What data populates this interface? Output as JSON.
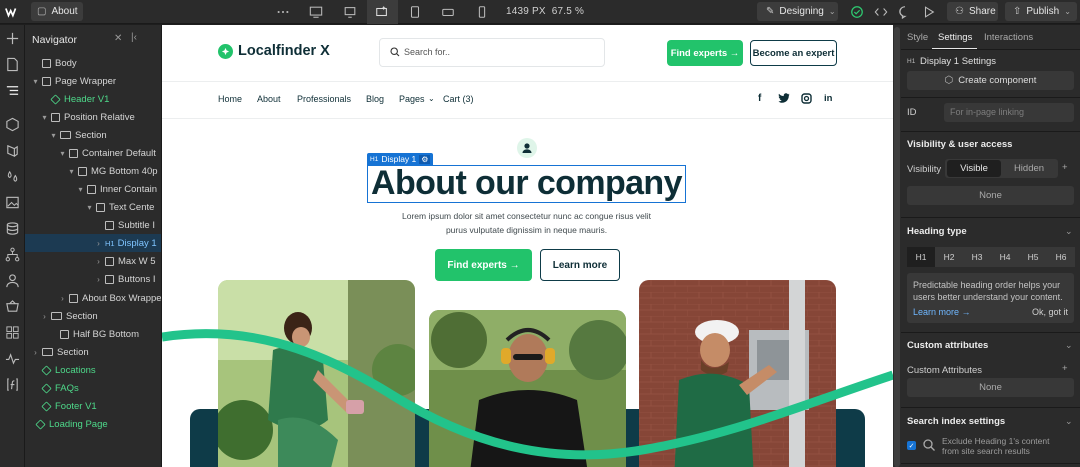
{
  "topbar": {
    "page_name": "About",
    "zoom_px": "1439 PX",
    "zoom_pct": "67.5 %",
    "mode": "Designing",
    "share": "Share",
    "publish": "Publish"
  },
  "navigator": {
    "title": "Navigator",
    "items": [
      {
        "label": "Body"
      },
      {
        "label": "Page Wrapper"
      },
      {
        "label": "Header V1"
      },
      {
        "label": "Position Relative"
      },
      {
        "label": "Section"
      },
      {
        "label": "Container Default"
      },
      {
        "label": "MG Bottom 40p"
      },
      {
        "label": "Inner Contain"
      },
      {
        "label": "Text Cente"
      },
      {
        "label": "Subtitle I"
      },
      {
        "label": "Display 1"
      },
      {
        "label": "Max W 5"
      },
      {
        "label": "Buttons I"
      },
      {
        "label": "About Box Wrappe"
      },
      {
        "label": "Section"
      },
      {
        "label": "Half BG Bottom"
      },
      {
        "label": "Section"
      },
      {
        "label": "Locations"
      },
      {
        "label": "FAQs"
      },
      {
        "label": "Footer V1"
      },
      {
        "label": "Loading Page"
      }
    ],
    "h1_tag": "H1"
  },
  "site": {
    "logo": "Localfinder X",
    "search_placeholder": "Search for..",
    "find_experts": "Find experts →",
    "become_expert": "Become an expert",
    "nav": [
      "Home",
      "About",
      "Professionals",
      "Blog",
      "Pages",
      "Cart (3)"
    ],
    "selection_tag": "Display 1",
    "heading": "About our company",
    "para_line1": "Lorem ipsum dolor sit amet consectetur nunc ac congue risus velit",
    "para_line2": "purus vulputate dignissim in neque mauris.",
    "cta_primary": "Find experts →",
    "cta_secondary": "Learn more",
    "accent": "#22c36b",
    "dark": "#0e3b48"
  },
  "panel": {
    "tabs": [
      "Style",
      "Settings",
      "Interactions"
    ],
    "settings_title": "Display 1 Settings",
    "create_component": "Create component",
    "id_label": "ID",
    "id_placeholder": "For in-page linking",
    "visibility_heading": "Visibility & user access",
    "visibility_label": "Visibility",
    "visible": "Visible",
    "hidden": "Hidden",
    "none1": "None",
    "heading_type": "Heading type",
    "heading_buttons": [
      "H1",
      "H2",
      "H3",
      "H4",
      "H5",
      "H6"
    ],
    "tip_line1": "Predictable heading order helps your",
    "tip_line2": "users better understand your content.",
    "learn_more": "Learn more →",
    "ok": "Ok, got it",
    "custom_attrs_heading": "Custom attributes",
    "custom_attrs_label": "Custom Attributes",
    "none2": "None",
    "search_index_heading": "Search index settings",
    "exclude_line1": "Exclude Heading 1's content",
    "exclude_line2": "from site search results"
  }
}
